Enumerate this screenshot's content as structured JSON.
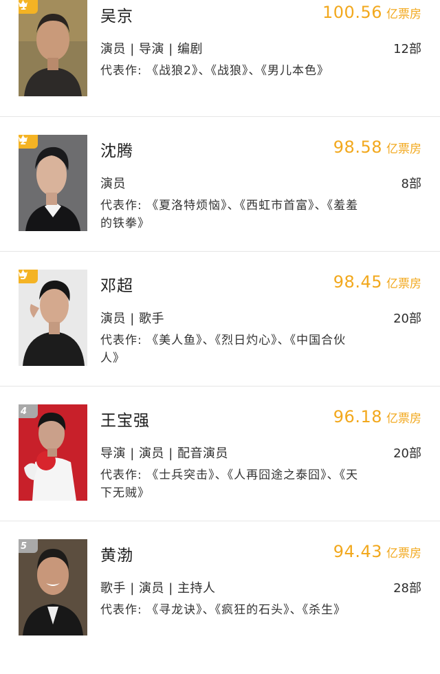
{
  "colors": {
    "box_office": "#f2a81d",
    "badge_top3": "#f4b324",
    "badge_other": "#a9a9a9",
    "divider": "#e6e6e6"
  },
  "rankings": [
    {
      "rank": "1",
      "name": "吴京",
      "box_office": "100.56",
      "unit": "亿票房",
      "roles": "演员 | 导演 | 编剧",
      "count": "12部",
      "works": "代表作: 《战狼2》、《战狼》、《男儿本色》",
      "photo": "actor-photo-wu-jing"
    },
    {
      "rank": "2",
      "name": "沈腾",
      "box_office": "98.58",
      "unit": "亿票房",
      "roles": "演员",
      "count": "8部",
      "works": "代表作: 《夏洛特烦恼》、《西虹市首富》、《羞羞的铁拳》",
      "photo": "actor-photo-shen-teng"
    },
    {
      "rank": "3",
      "name": "邓超",
      "box_office": "98.45",
      "unit": "亿票房",
      "roles": "演员 | 歌手",
      "count": "20部",
      "works": "代表作: 《美人鱼》、《烈日灼心》、《中国合伙人》",
      "photo": "actor-photo-deng-chao"
    },
    {
      "rank": "4",
      "name": "王宝强",
      "box_office": "96.18",
      "unit": "亿票房",
      "roles": "导演 | 演员 | 配音演员",
      "count": "20部",
      "works": "代表作: 《士兵突击》、《人再囧途之泰囧》、《天下无贼》",
      "photo": "actor-photo-wang-baoqiang"
    },
    {
      "rank": "5",
      "name": "黄渤",
      "box_office": "94.43",
      "unit": "亿票房",
      "roles": "歌手 | 演员 | 主持人",
      "count": "28部",
      "works": "代表作: 《寻龙诀》、《疯狂的石头》、《杀生》",
      "photo": "actor-photo-huang-bo"
    }
  ]
}
